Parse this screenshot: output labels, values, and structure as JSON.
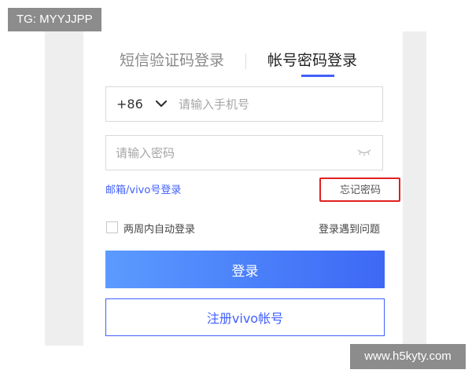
{
  "login_tabs": {
    "sms_label": "短信验证码登录",
    "password_label": "帐号密码登录",
    "active": "password"
  },
  "phone_field": {
    "country_code": "+86",
    "placeholder": "请输入手机号",
    "value": ""
  },
  "password_field": {
    "placeholder": "请输入密码",
    "value": ""
  },
  "links": {
    "email_vivo_login": "邮箱/vivo号登录",
    "forgot_password": "忘记密码",
    "login_problem": "登录遇到问题"
  },
  "auto_login": {
    "label": "两周内自动登录",
    "checked": false
  },
  "buttons": {
    "login": "登录",
    "register": "注册vivo帐号"
  },
  "watermarks": {
    "top_left": "TG: MYYJJPP",
    "bottom_right": "www.h5kyty.com"
  },
  "colors": {
    "accent": "#415fff",
    "highlight_box": "#e02020",
    "login_gradient_start": "#5b9bff",
    "login_gradient_end": "#3d68f5"
  },
  "icons": {
    "country_dropdown": "chevron-down-icon",
    "password_visibility": "eye-closed-icon"
  }
}
